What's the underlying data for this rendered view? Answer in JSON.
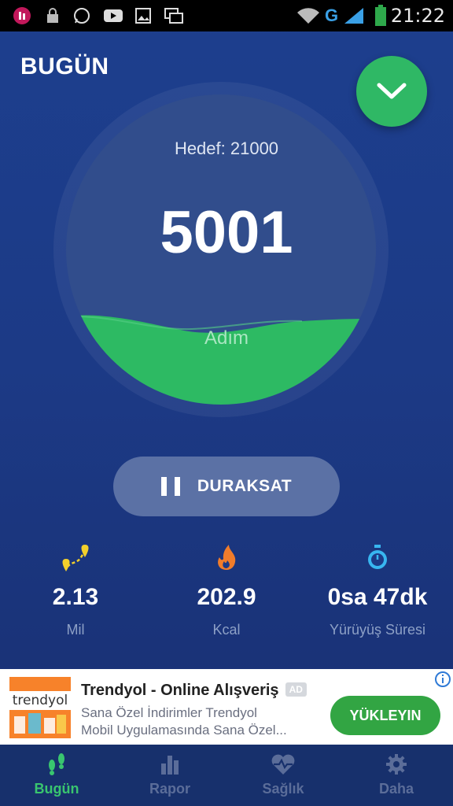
{
  "status_bar": {
    "time": "21:22",
    "network": "G"
  },
  "header": {
    "title": "BUGÜN"
  },
  "progress": {
    "goal_label": "Hedef: 21000",
    "steps": "5001",
    "unit": "Adım",
    "fill_fraction": 0.238
  },
  "pause_button": {
    "label": "DURAKSAT"
  },
  "stats": [
    {
      "icon": "map-route-icon",
      "value": "2.13",
      "label": "Mil"
    },
    {
      "icon": "flame-icon",
      "value": "202.9",
      "label": "Kcal"
    },
    {
      "icon": "stopwatch-icon",
      "value": "0sa 47dk",
      "label": "Yürüyüş Süresi"
    }
  ],
  "ad": {
    "brand": "trendyol",
    "title": "Trendyol - Online Alışveriş",
    "badge": "AD",
    "line1": "Sana Özel İndirimler Trendyol",
    "line2": "Mobil Uygulamasında Sana Özel...",
    "cta": "YÜKLEYIN"
  },
  "nav": [
    {
      "label": "Bugün",
      "icon": "footsteps-icon",
      "active": true
    },
    {
      "label": "Rapor",
      "icon": "bar-chart-icon",
      "active": false
    },
    {
      "label": "Sağlık",
      "icon": "heart-pulse-icon",
      "active": false
    },
    {
      "label": "Daha",
      "icon": "gear-icon",
      "active": false
    }
  ],
  "colors": {
    "accent": "#39c56f",
    "background": "#1c3a86",
    "fab": "#2fb865"
  }
}
